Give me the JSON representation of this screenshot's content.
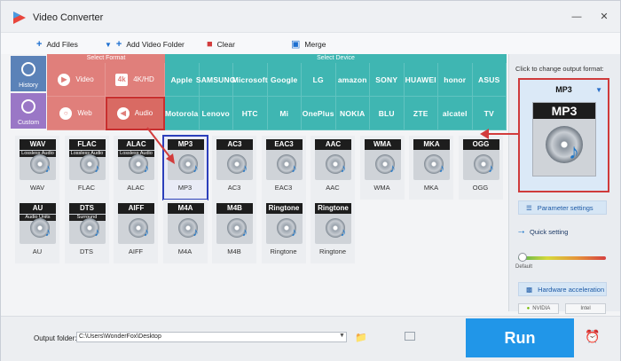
{
  "window": {
    "title": "Video Converter"
  },
  "toolbar": {
    "add_files": "Add Files",
    "add_video_folder": "Add Video Folder",
    "clear": "Clear",
    "merge": "Merge"
  },
  "sidebar": {
    "history": "History",
    "custom": "Custom"
  },
  "format_band": {
    "header": "Select Format",
    "video": "Video",
    "fourk": "4K/HD",
    "web": "Web",
    "audio": "Audio"
  },
  "device_band": {
    "header": "Select Device",
    "row1": [
      "Apple",
      "SAMSUNG",
      "Microsoft",
      "Google",
      "LG",
      "amazon",
      "SONY",
      "HUAWEI",
      "honor",
      "ASUS"
    ],
    "row2": [
      "Motorola",
      "Lenovo",
      "HTC",
      "Mi",
      "OnePlus",
      "NOKIA",
      "BLU",
      "ZTE",
      "alcatel",
      "TV"
    ]
  },
  "formats": [
    {
      "name": "WAV",
      "sub": "Lossless Audio"
    },
    {
      "name": "FLAC",
      "sub": "Lossless Audio"
    },
    {
      "name": "ALAC",
      "sub": "Lossless Audio"
    },
    {
      "name": "MP3"
    },
    {
      "name": "AC3"
    },
    {
      "name": "EAC3"
    },
    {
      "name": "AAC"
    },
    {
      "name": "WMA"
    },
    {
      "name": "MKA"
    },
    {
      "name": "OGG"
    },
    {
      "name": "AU",
      "sub": "Audio Units"
    },
    {
      "name": "DTS",
      "sub": "Surround"
    },
    {
      "name": "AIFF"
    },
    {
      "name": "M4A"
    },
    {
      "name": "M4B"
    },
    {
      "name": "Ringtone"
    },
    {
      "name": "Ringtone"
    }
  ],
  "right_panel": {
    "click_label": "Click to change output format:",
    "output_format": "MP3",
    "parameter_settings": "Parameter settings",
    "quick_setting": "Quick setting",
    "default": "Default",
    "hardware_acceleration": "Hardware acceleration",
    "nvidia": "NVIDIA",
    "intel": "Intel"
  },
  "bottom": {
    "output_folder_label": "Output folder:",
    "output_folder_value": "C:\\Users\\WonderFox\\Desktop",
    "run": "Run"
  }
}
